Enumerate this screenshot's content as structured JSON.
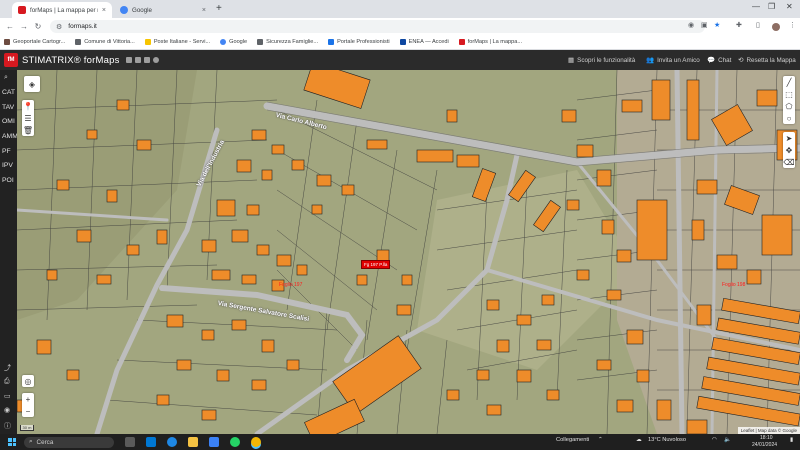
{
  "browser": {
    "tabs": [
      {
        "title": "forMaps | La mappa per navigare",
        "active": true,
        "favicon_color": "#d71920"
      },
      {
        "title": "Google",
        "active": false,
        "favicon_color": "#4285f4"
      }
    ],
    "new_tab_label": "+",
    "url": "formaps.it",
    "bookmarks": [
      {
        "label": "Geoportale Cartogr...",
        "color": "#6d4c41"
      },
      {
        "label": "Comune di Vittoria...",
        "color": "#5f6368"
      },
      {
        "label": "Poste Italiane - Servi...",
        "color": "#f7c500"
      },
      {
        "label": "Google",
        "color": "#4285f4"
      },
      {
        "label": "Sicurezza Famiglie...",
        "color": "#5f6368"
      },
      {
        "label": "Portale Professionisti",
        "color": "#1a73e8"
      },
      {
        "label": "ENEA — Accedi",
        "color": "#0d47a1"
      },
      {
        "label": "forMaps | La mappa...",
        "color": "#d71920"
      }
    ]
  },
  "app": {
    "logo_text": "fM",
    "brand": "STIMATRIX® forMaps",
    "menu": [
      {
        "label": "Scopri le funzionalità",
        "icon": "grid-icon"
      },
      {
        "label": "Invita un Amico",
        "icon": "users-icon"
      },
      {
        "label": "Chat",
        "icon": "chat-icon"
      },
      {
        "label": "Resetta la Mappa",
        "icon": "reset-icon"
      }
    ],
    "left_menu": [
      "CAT",
      "TAV",
      "OMI",
      "AMM",
      "PF",
      "IPV",
      "POI"
    ]
  },
  "map": {
    "marker_label": "Fg 197 P.lla",
    "road_labels": [
      "Via Sergente Salvatore Scalisi",
      "Via Carlo Alberto",
      "Via dell'Industria"
    ],
    "red_labels": [
      "Foglio 197",
      "Foglio 198"
    ],
    "attribution": "Leaflet | Map data © Google",
    "scale_text": "30 m",
    "zoom_in": "+",
    "zoom_out": "−"
  },
  "taskbar": {
    "search_placeholder": "Cerca",
    "network": "Collegamenti",
    "weather": "13°C  Nuvoloso",
    "time": "18:10",
    "date": "24/01/2024"
  },
  "colors": {
    "brand_red": "#d71920",
    "building_orange": "#ee8c2a",
    "terrain": "#a2a67f",
    "road": "#bdbdbd"
  }
}
